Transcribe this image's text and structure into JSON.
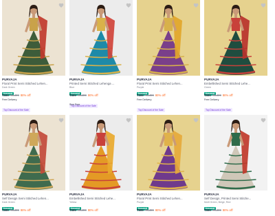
{
  "products": [
    {
      "brand": "PURVAJA",
      "title": "Floral Print Semi Stitched Lehen...",
      "color": "Dark Green",
      "badge": "Assured",
      "price": "₹599",
      "mrp": "₹3,499",
      "discount": "80% off",
      "delivery": "Free Delivery",
      "tag": "Top Discount of the Sale",
      "size": "",
      "bg": "#ece3d2",
      "dress": "#3d5c3a",
      "accent": "#c9a24a",
      "dupatta": "#c0392b"
    },
    {
      "brand": "PURVAJA",
      "title": "Printed Semi Stitched Lehenga ...",
      "color": "Blue",
      "badge": "Assured",
      "price": "₹599",
      "mrp": "₹3,499",
      "discount": "80% off",
      "delivery": "",
      "tag": "Top Discount of the Sale",
      "size": "Size Free",
      "bg": "#ececec",
      "dress": "#1e8aa8",
      "accent": "#d9b24a",
      "dupatta": "#d0433a"
    },
    {
      "brand": "PURVAJA",
      "title": "Floral Print Semi Stitched Lehen...",
      "color": "Purple",
      "badge": "Assured",
      "price": "₹599",
      "mrp": "₹3,499",
      "discount": "80% off",
      "delivery": "Free Delivery",
      "tag": "Top Discount of the Sale",
      "size": "",
      "bg": "#e6d28e",
      "dress": "#7a3f8a",
      "accent": "#d8b14a",
      "dupatta": "#e2a62a"
    },
    {
      "brand": "PURVAJA",
      "title": "Embellished Semi Stitched Lehe...",
      "color": "Green",
      "badge": "Assured",
      "price": "₹599",
      "mrp": "₹3,499",
      "discount": "80% off",
      "delivery": "Free Delivery",
      "tag": "Top Discount of the Sale",
      "size": "",
      "bg": "#e6d28e",
      "dress": "#1f4d3f",
      "accent": "#c8413a",
      "dupatta": "#b8322c"
    },
    {
      "brand": "PURVAJA",
      "title": "Self Design Semi Stitched Lehen...",
      "color": "Dark Green",
      "badge": "Assured",
      "price": "₹599",
      "mrp": "₹3,499",
      "discount": "80% off",
      "delivery": "",
      "tag": "",
      "size": "",
      "bg": "#ece3d2",
      "dress": "#3f6b4e",
      "accent": "#cfa85a",
      "dupatta": "#c24a3a"
    },
    {
      "brand": "PURVAJA",
      "title": "Embellished Semi Stitched Lehe...",
      "color": "Yellow",
      "badge": "Assured",
      "price": "₹599",
      "mrp": "₹3,499",
      "discount": "80% off",
      "delivery": "",
      "tag": "",
      "size": "",
      "bg": "#ececec",
      "dress": "#e49a25",
      "accent": "#c8413a",
      "dupatta": "#e9a92d"
    },
    {
      "brand": "PURVAJA",
      "title": "Floral Print Semi Stitched Lehen...",
      "color": "Purple",
      "badge": "Assured",
      "price": "₹599",
      "mrp": "₹3,499",
      "discount": "80% off",
      "delivery": "",
      "tag": "",
      "size": "",
      "bg": "#e6d28e",
      "dress": "#6f3a8c",
      "accent": "#e0b24a",
      "dupatta": "#e6a93b"
    },
    {
      "brand": "PURVAJA",
      "title": "Self Design, Printed Semi Stitche...",
      "color": "Multi Green, Beige, Red",
      "badge": "Assured",
      "price": "₹599",
      "mrp": "₹3,499",
      "discount": "80% off",
      "delivery": "",
      "tag": "",
      "size": "",
      "bg": "#f2f2f2",
      "dress": "#cfc7b8",
      "accent": "#2f6b4a",
      "dupatta": "#c0392b"
    }
  ]
}
